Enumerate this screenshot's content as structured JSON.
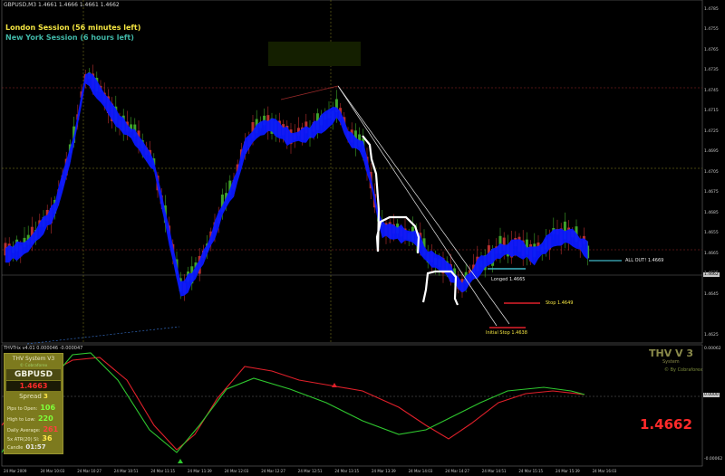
{
  "window": {
    "symbol_title": "GBPUSD,M3  1.4661 1.4666 1.4661 1.4662"
  },
  "sessions": {
    "london": "London Session (56 minutes left)",
    "new_york": "New York Session (6 hours left)"
  },
  "annotations": {
    "all_out": "ALL OUT! 1.4669",
    "longed": "Longed 1.4665",
    "stop": "Stop 1.4649",
    "initial_stop": "Initial Stop 1.4638"
  },
  "indicator": {
    "title": "THVTrix v4.01 0.000046 -0.000047",
    "brand_title": "THV V 3",
    "brand_sub": "System",
    "brand_by": "© By Cobraforex",
    "big_price": "1.4662",
    "scale_top": "0.00062",
    "scale_mid": "0.0000",
    "scale_bottom": "-0.00062"
  },
  "panel": {
    "system": "THV System V3",
    "by": "© Cobraforex",
    "pair": "GBPUSD",
    "price": "1.4663",
    "spread_label": "Spread",
    "spread_value": "3",
    "pips_label": "Pips to Open:",
    "pips_value": "106",
    "hilo_label": "High to Low:",
    "hilo_value": "220",
    "daily_label": "Daily Average:",
    "daily_value": "261",
    "atr_label": "5x ATR(20) Sl:",
    "atr_value": "36",
    "candle_label": "Candle",
    "candle_value": "01:57"
  },
  "price_scale": [
    "1.4785",
    "1.4765",
    "1.4745",
    "1.4725",
    "1.4705",
    "1.4685",
    "1.4665",
    "1.4645",
    "1.4625"
  ],
  "price_scale_extra": [
    "1.4755",
    "1.4735",
    "1.4715",
    "1.4695",
    "1.4675",
    "1.4655",
    "1.4635"
  ],
  "current_price_box": "1.4662",
  "time_axis": [
    "24 Mar 2009",
    "24 Mar 10:03",
    "24 Mar 10:27",
    "24 Mar 10:51",
    "24 Mar 11:15",
    "24 Mar 11:39",
    "24 Mar 12:03",
    "24 Mar 12:27",
    "24 Mar 12:51",
    "24 Mar 13:15",
    "24 Mar 13:39",
    "24 Mar 14:03",
    "24 Mar 14:27",
    "24 Mar 14:51",
    "24 Mar 15:15",
    "24 Mar 15:39",
    "24 Mar 16:03"
  ],
  "colors": {
    "bull_candle": "#3fa32a",
    "bear_candle": "#b83030",
    "ma_band": "#0a18ff",
    "session_yellow": "#f5e642",
    "session_teal": "#41b8a8",
    "signal_red": "#e0202a",
    "signal_green": "#2fc82f"
  }
}
